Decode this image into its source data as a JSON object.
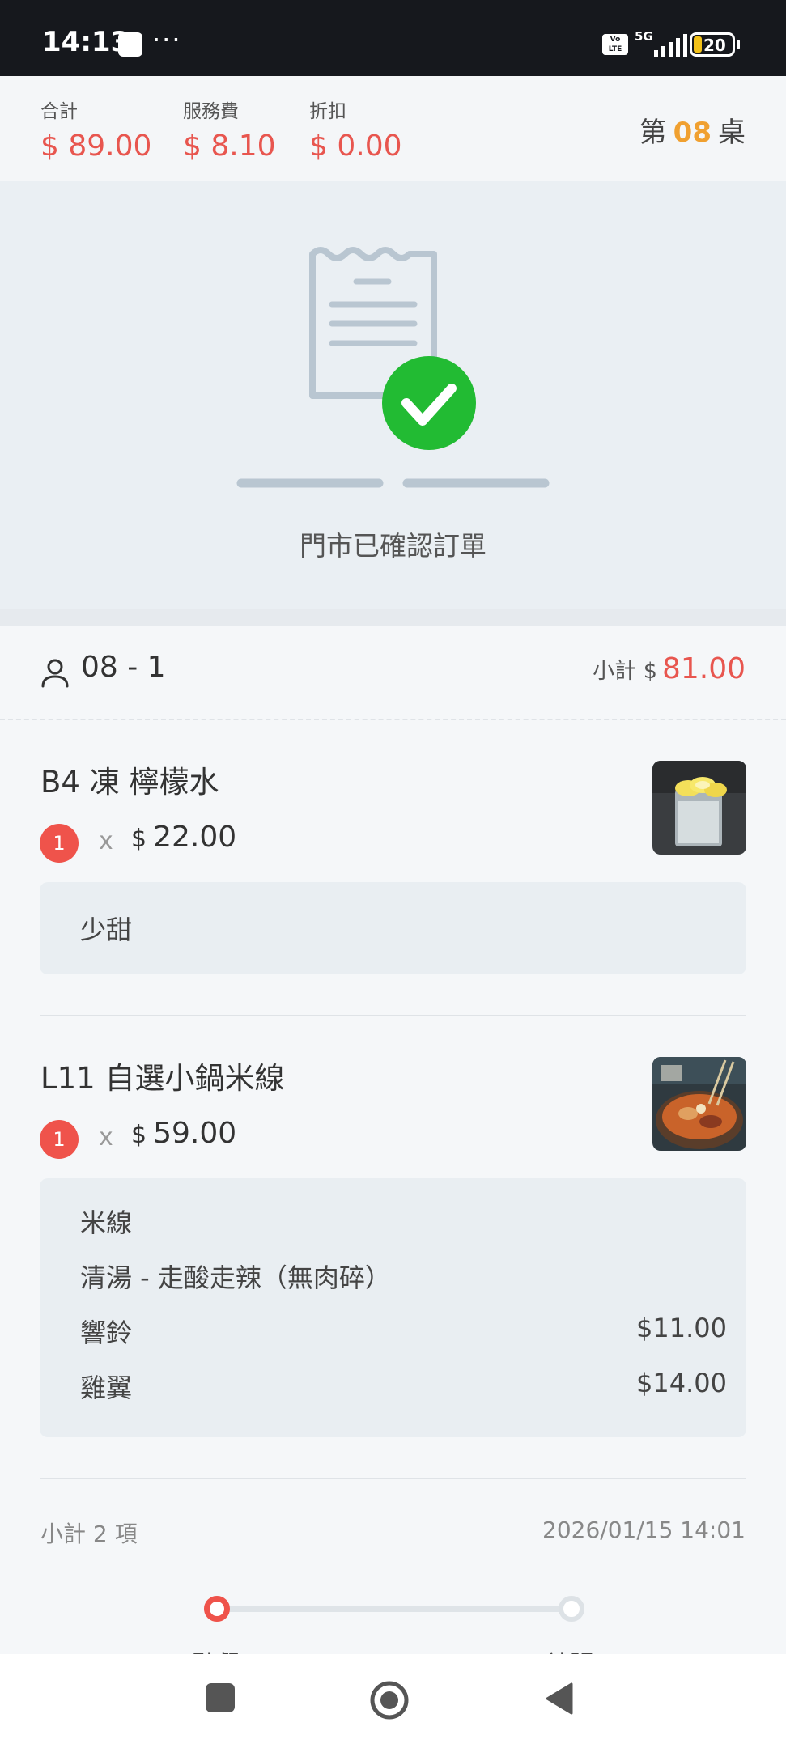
{
  "status_bar": {
    "time": "14:13",
    "more": "···",
    "volte": "Vo LTE",
    "network": "5G",
    "battery": "20"
  },
  "summary": {
    "total_label": "合計",
    "total_value": "$ 89.00",
    "service_label": "服務費",
    "service_value": "$ 8.10",
    "discount_label": "折扣",
    "discount_value": "$ 0.00",
    "table_prefix": "第",
    "table_number": "08",
    "table_suffix": "桌"
  },
  "hero": {
    "icon": "receipt-check-icon",
    "status_text": "門市已確認訂單"
  },
  "order": {
    "seat": "08 - 1",
    "subtotal_label": "小計 $",
    "subtotal_value": "81.00",
    "items": [
      {
        "name": "B4 凍 檸檬水",
        "qty": "1",
        "times": "x",
        "currency": "$",
        "price": "22.00",
        "thumbnail": "lemon-water-photo",
        "notes": [
          {
            "text": "少甜",
            "price": ""
          }
        ]
      },
      {
        "name": "L11 自選小鍋米線",
        "qty": "1",
        "times": "x",
        "currency": "$",
        "price": "59.00",
        "thumbnail": "rice-noodle-pot-photo",
        "notes": [
          {
            "text": "米線",
            "price": ""
          },
          {
            "text": "清湯 - 走酸走辣（無肉碎）",
            "price": ""
          },
          {
            "text": "響鈴",
            "price": "$11.00"
          },
          {
            "text": "雞翼",
            "price": "$14.00"
          }
        ]
      }
    ],
    "footer_count": "小計 2 項",
    "footer_time": "2026/01/15 14:01",
    "progress": {
      "current_step": 0,
      "steps": [
        "點餐",
        "結賬"
      ]
    }
  },
  "nav": {
    "recents_icon": "square-icon",
    "home_icon": "circle-home-icon",
    "back_icon": "triangle-back-icon"
  },
  "colors": {
    "accent_red": "#e8564f",
    "table_orange": "#f0a030",
    "check_green": "#22bb33"
  }
}
